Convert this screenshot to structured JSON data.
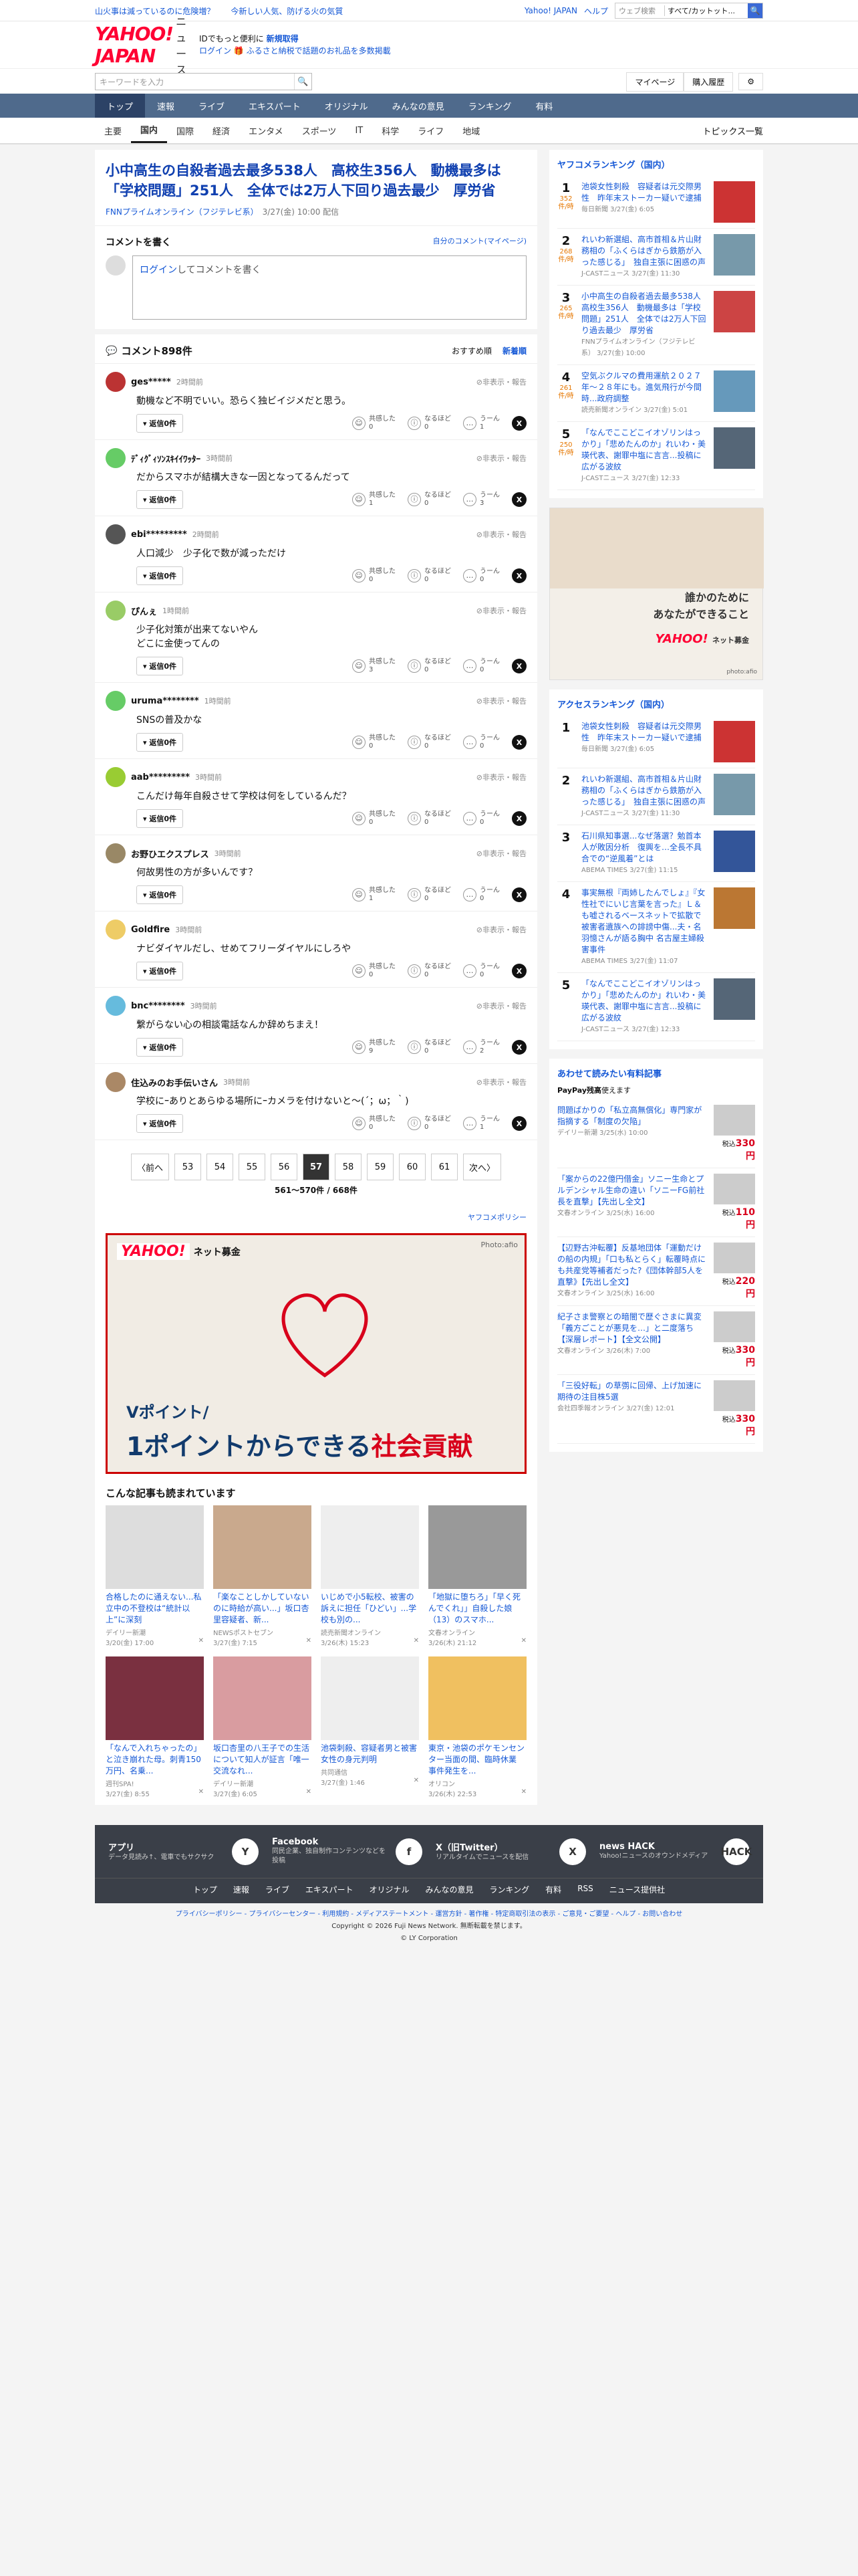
{
  "topbar": {
    "left1": "山火事は減っているのに危険増？",
    "left2": "今新しい人気、防げる火の気質",
    "yj": "Yahoo! JAPAN",
    "help": "ヘルプ",
    "search_placeholder": "ウェブ検索",
    "select": "すべて/カットット...",
    "search_icon": "search-icon"
  },
  "header": {
    "logo": "YAHOO! JAPAN",
    "logo_sub": "ニュース",
    "promo1a": "IDでもっと便利に",
    "promo1b": "新規取得",
    "promo2a": "ログイン",
    "promo2b": "ふるさと納税で話題のお礼品を多数掲載"
  },
  "search": {
    "placeholder": "キーワードを入力",
    "mypage": "マイページ",
    "purchased": "購入履歴"
  },
  "nav": [
    {
      "label": "トップ",
      "active": true
    },
    {
      "label": "速報"
    },
    {
      "label": "ライブ"
    },
    {
      "label": "エキスパート"
    },
    {
      "label": "オリジナル"
    },
    {
      "label": "みんなの意見"
    },
    {
      "label": "ランキング"
    },
    {
      "label": "有料"
    }
  ],
  "subnav": [
    {
      "label": "主要"
    },
    {
      "label": "国内",
      "active": true
    },
    {
      "label": "国際"
    },
    {
      "label": "経済"
    },
    {
      "label": "エンタメ"
    },
    {
      "label": "スポーツ"
    },
    {
      "label": "IT"
    },
    {
      "label": "科学"
    },
    {
      "label": "ライフ"
    },
    {
      "label": "地域"
    }
  ],
  "subnav_right": "トピックス一覧",
  "article": {
    "title": "小中高生の自殺者過去最多538人　高校生356人　動機最多は「学校問題」251人　全体では2万人下回り過去最少　厚労省",
    "source": "FNNプライムオンライン（フジテレビ系）",
    "date": "3/27(金) 10:00 配信"
  },
  "comment_box": {
    "title": "コメントを書く",
    "mine": "自分のコメント(マイページ)",
    "login": "ログイン",
    "placeholder": "してコメントを書く"
  },
  "comments_header": {
    "title": "コメント898件",
    "sort1": "おすすめ順",
    "sort2": "新着順"
  },
  "comment_common": {
    "reply": "返信0件",
    "hide_report": "非表示・報告",
    "a1": "共感した",
    "a2": "なるほど",
    "a3": "うーん"
  },
  "comments": [
    {
      "name": "ges*****",
      "time": "2時間前",
      "body": "動機など不明でいい。恐らく独ビイジメだと思う。",
      "c1": "0",
      "c2": "0",
      "c3": "1",
      "color": "#b33"
    },
    {
      "name": "ﾃﾞｨｸﾞｨｿﾝｽｷｲｲﾜｯﾀｰ",
      "time": "3時間前",
      "body": "だからスマホが結構大きな一因となってるんだって",
      "c1": "1",
      "c2": "0",
      "c3": "3",
      "color": "#6c6"
    },
    {
      "name": "ebi*********",
      "time": "2時間前",
      "body": "人口減少　少子化で数が減っただけ",
      "c1": "0",
      "c2": "0",
      "c3": "0",
      "color": "#555"
    },
    {
      "name": "ぴんぇ",
      "time": "1時間前",
      "body": "少子化対策が出来てないやん\nどこに金使ってんの",
      "c1": "3",
      "c2": "0",
      "c3": "0",
      "color": "#9c6"
    },
    {
      "name": "uruma********",
      "time": "1時間前",
      "body": "SNSの普及かな",
      "c1": "0",
      "c2": "0",
      "c3": "0",
      "color": "#6c6"
    },
    {
      "name": "aab*********",
      "time": "3時間前",
      "body": "こんだけ毎年自殺させて学校は何をしているんだ？",
      "c1": "0",
      "c2": "0",
      "c3": "0",
      "color": "#9c3"
    },
    {
      "name": "お野ひエクスプレス",
      "time": "3時間前",
      "body": "何故男性の方が多いんです？",
      "c1": "1",
      "c2": "0",
      "c3": "0",
      "color": "#986"
    },
    {
      "name": "Goldfire",
      "time": "3時間前",
      "body": "ナビダイヤルだし、せめてフリーダイヤルにしろや",
      "c1": "0",
      "c2": "0",
      "c3": "0",
      "color": "#ec6"
    },
    {
      "name": "bnc********",
      "time": "3時間前",
      "body": "繋がらない心の相談電話なんか辞めちまえ！",
      "c1": "9",
      "c2": "0",
      "c3": "2",
      "color": "#6bd"
    },
    {
      "name": "住込みのお手伝いさん",
      "time": "3時間前",
      "body": "学校にｰありとあらゆる場所にｰカメラを付けないと〜(´；ω；｀)",
      "c1": "0",
      "c2": "0",
      "c3": "1",
      "color": "#a86"
    }
  ],
  "pager": {
    "prev": "〈前へ",
    "next": "次へ〉",
    "pages": [
      "53",
      "54",
      "55",
      "56",
      "57",
      "58",
      "59",
      "60",
      "61"
    ],
    "current": "57",
    "info": "561〜570件 / 668件"
  },
  "policy": "ヤフコメポリシー",
  "banner": {
    "logo": "YAHOO!",
    "logo_sub": "ネット募金",
    "photo": "Photo:afio",
    "line1": "Vポイント/",
    "line2a": "1ポイントからできる",
    "line2b": "社会貢献"
  },
  "also": {
    "title": "こんな記事も読まれています",
    "items": [
      {
        "title": "合格したのに通えない...私立中の不登校は“統計以上”に深刻",
        "src": "デイリー新潮",
        "date": "3/20(金) 17:00"
      },
      {
        "title": "「楽なことしかしていないのに時給が高い...」坂口杏里容疑者、新...",
        "src": "NEWSポストセブン",
        "date": "3/27(金) 7:15"
      },
      {
        "title": "いじめで小5転校、被害の訴えに担任「ひどい」...学校も別の...",
        "src": "読売新聞オンライン",
        "date": "3/26(木) 15:23"
      },
      {
        "title": "「地獄に堕ちろ」「早く死んでくれ」」自殺した娘（13）のスマホ...",
        "src": "文春オンライン",
        "date": "3/26(木) 21:12"
      },
      {
        "title": "「なんで入れちゃったの」と泣き崩れた母。刺青150万円、名乗...",
        "src": "週刊SPA!",
        "date": "3/27(金) 8:55"
      },
      {
        "title": "坂口杏里の八王子での生活について知人が証言「唯一交流なれ...",
        "src": "デイリー新潮",
        "date": "3/27(金) 6:05"
      },
      {
        "title": "池袋刺殺、容疑者男と被害女性の身元判明",
        "src": "共同通信",
        "date": "3/27(金) 1:46"
      },
      {
        "title": "東京・池袋のポケモンセンター当面の間、臨時休業　事件発生を...",
        "src": "オリコン",
        "date": "3/26(木) 22:53"
      }
    ]
  },
  "ranking": {
    "title": "ヤフコメランキング（国内）",
    "unit": "件/時",
    "items": [
      {
        "num": "1",
        "count": "352",
        "title": "池袋女性刺殺　容疑者は元交際男性　昨年末ストーカー疑いで逮捕",
        "src": "毎日新聞 3/27(金) 6:05"
      },
      {
        "num": "2",
        "count": "268",
        "title": "れいわ新選組、高市首相＆片山財務相の「ふくらはぎから鉄筋が入った感じる」　独自主張に困惑の声",
        "src": "J-CASTニュース 3/27(金) 11:30"
      },
      {
        "num": "3",
        "count": "265",
        "title": "小中高生の自殺者過去最多538人　高校生356人　動機最多は「学校問題」251人　全体では2万人下回り過去最少　厚労省",
        "src": "FNNプライムオンライン（フジテレビ系） 3/27(金) 10:00"
      },
      {
        "num": "4",
        "count": "261",
        "title": "空気ぶクルマの費用運航２０２７年〜２８年にも。進気飛行が今間時...政府調整",
        "src": "読売新聞オンライン 3/27(金) 5:01"
      },
      {
        "num": "5",
        "count": "250",
        "title": "「なんでここどこイオゾリンはっかり」「悲めたんのか」れいわ・美瑛代表、謝罪中塩に言言...投稿に広がる波紋",
        "src": "J-CASTニュース 3/27(金) 12:33"
      }
    ]
  },
  "ad": {
    "line1": "誰かのために",
    "line2": "あなたができること",
    "logo": "YAHOO!",
    "sub": "ネット募金",
    "photo": "photo:afio"
  },
  "access": {
    "title": "アクセスランキング（国内）",
    "items": [
      {
        "num": "1",
        "title": "池袋女性刺殺　容疑者は元交際男性　昨年末ストーカー疑いで逮捕",
        "src": "毎日新聞 3/27(金) 6:05"
      },
      {
        "num": "2",
        "title": "れいわ新選組、高市首相＆片山財務相の「ふくらはぎから鉄筋が入った感じる」　独自主張に困惑の声",
        "src": "J-CASTニュース 3/27(金) 11:30"
      },
      {
        "num": "3",
        "title": "石川県知事選...なぜ落選？勉首本人が敗因分析　復興を…全長不具合での“逆風着”とは",
        "src": "ABEMA TIMES 3/27(金) 11:15"
      },
      {
        "num": "4",
        "title": "事実無根『両姉したんでしょ』『女性社でにいじ言葉を言った』Ｌ＆も嘘されるベースネットで拡散で被害者遺族への誹謗中傷...夫・名羽憶さんが語る胸中 名古屋主婦殺害事件",
        "src": "ABEMA TIMES 3/27(金) 11:07"
      },
      {
        "num": "5",
        "title": "「なんでここどこイオゾリンはっかり」「悲めたんのか」れいわ・美瑛代表、謝罪中塩に言言...投稿に広がる波紋",
        "src": "J-CASTニュース 3/27(金) 12:33"
      }
    ]
  },
  "paid": {
    "title": "あわせて読みたい有料記事",
    "sub": "PayPay残高",
    "sub2": "使えます",
    "items": [
      {
        "title": "問題ばかりの「私立高無償化」専門家が指摘する「制度の欠陥」",
        "src": "デイリー新潮 3/25(水) 10:00",
        "yen": "税込",
        "price": "330円"
      },
      {
        "title": "「案からの22億円借金」ソニー生命とプルデンシャル生命の違い「ソニーFG前社長を直撃」【先出し全文】",
        "src": "文春オンライン 3/25(水) 16:00",
        "yen": "税込",
        "price": "110円"
      },
      {
        "title": "【辺野古沖転覆】反基地団体「運動だけの船の内規」「口も私とらく」転覆時点にも共産党等補者だった?《団体幹部5人を直撃》【先出し全文】",
        "src": "文春オンライン 3/25(水) 16:00",
        "yen": "税込",
        "price": "220円"
      },
      {
        "title": "紀子さま警察との暗闇で歴ぐさまに異変「義方ごことが悪見を…」と二度落ち【深層レポート】【全文公開】",
        "src": "文春オンライン 3/26(木) 7:00",
        "yen": "税込",
        "price": "330円"
      },
      {
        "title": "「三役好転」の草彅に回帰、上げ加速に期待の注目株5選",
        "src": "会社四季報オンライン 3/27(金) 12:01",
        "yen": "税込",
        "price": "330円"
      }
    ]
  },
  "footer": {
    "apps": [
      {
        "title": "アプリ",
        "desc": "データ見読み↑、電車でもサクサク",
        "icon": "Y"
      },
      {
        "title": "Facebook",
        "desc": "同民企業、独自制作コンテンツなどを投稿",
        "icon": "f"
      },
      {
        "title": "X（旧Twitter）",
        "desc": "リアルタイムでニュースを配信",
        "icon": "X"
      },
      {
        "title": "news HACK",
        "desc": "Yahoo!ニュースのオウンドメディア",
        "icon": "HACK"
      }
    ],
    "links": [
      "トップ",
      "速報",
      "ライブ",
      "エキスパート",
      "オリジナル",
      "みんなの意見",
      "ランキング",
      "有料",
      "RSS",
      "ニュース提供社"
    ],
    "legal1": "プライバシーポリシー - プライバシーセンター - 利用規約 - メディアステートメント - 運営方針 - 著作権 - 特定商取引法の表示 - ご意見・ご要望 - ヘルプ - お問い合わせ",
    "legal2": "Copyright © 2026 Fuji News Network. 無断転載を禁じます。",
    "legal3": "© LY Corporation"
  }
}
